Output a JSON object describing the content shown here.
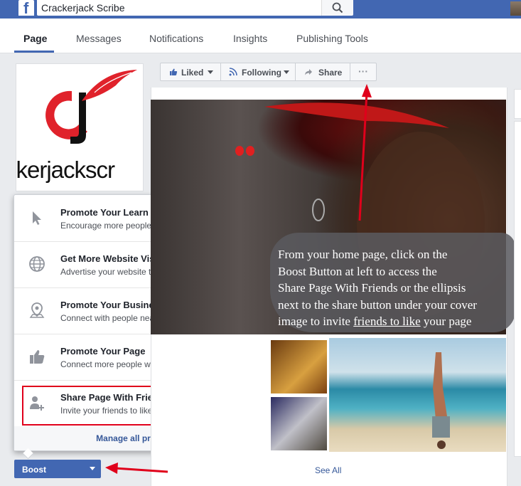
{
  "topbar": {
    "search_value": "Crackerjack Scribe",
    "logo_glyph": "f",
    "brand_color": "#4267b2"
  },
  "tabs": [
    {
      "label": "Page",
      "active": true
    },
    {
      "label": "Messages",
      "active": false
    },
    {
      "label": "Notifications",
      "active": false
    },
    {
      "label": "Insights",
      "active": false
    },
    {
      "label": "Publishing Tools",
      "active": false
    }
  ],
  "profile": {
    "logo_text": "ckerjackscr"
  },
  "actions": {
    "liked": "Liked",
    "following": "Following",
    "share": "Share",
    "more": "···"
  },
  "promotions": [
    {
      "title": "Promote Your Learn More Button",
      "subtitle": "Encourage more people to take an action",
      "icon": "cursor-icon"
    },
    {
      "title": "Get More Website Visitors",
      "subtitle": "Advertise your website to a large audience",
      "icon": "globe-icon"
    },
    {
      "title": "Promote Your Business Locally",
      "subtitle": "Connect with people nearby",
      "icon": "location-pin-icon"
    },
    {
      "title": "Promote Your Page",
      "subtitle": "Connect more people with your Page",
      "icon": "thumbs-up-icon"
    },
    {
      "title": "Share Page With Friends",
      "subtitle": "Invite your friends to like your Page",
      "icon": "add-person-icon"
    }
  ],
  "manage_label": "Manage all promotions",
  "boost_label": "Boost",
  "annotation": {
    "line1": "From your home page, click on the",
    "line2": "Boost Button at left to access the",
    "line3": "Share Page With Friends or the ellipsis",
    "line4": "next to the share button under your cover",
    "line5a": "image to invite ",
    "line5b": "friends to like",
    "line5c": " your page"
  },
  "photos": {
    "see_all": "See All"
  },
  "colors": {
    "highlight": "#e0001b",
    "link": "#365899"
  }
}
